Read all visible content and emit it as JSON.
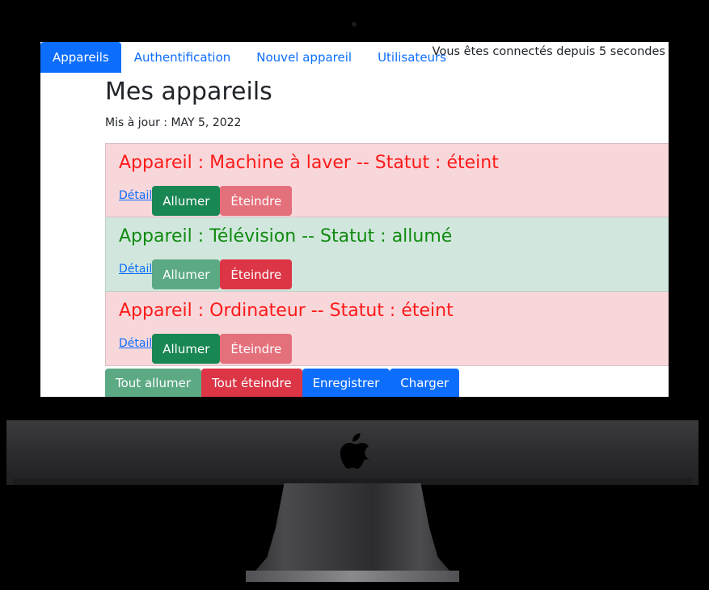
{
  "nav": {
    "items": [
      {
        "label": "Appareils",
        "active": true
      },
      {
        "label": "Authentification",
        "active": false
      },
      {
        "label": "Nouvel appareil",
        "active": false
      },
      {
        "label": "Utilisateurs",
        "active": false
      }
    ],
    "connected_text": "Vous êtes connectés depuis 5 secondes"
  },
  "main": {
    "title": "Mes appareils",
    "updated": "Mis à jour : MAY 5, 2022"
  },
  "devices": [
    {
      "title": "Appareil : Machine à laver -- Statut : éteint",
      "status": "off",
      "detail_label": "Détail",
      "on_label": "Allumer",
      "off_label": "Éteindre"
    },
    {
      "title": "Appareil : Télévision -- Statut : allumé",
      "status": "on",
      "detail_label": "Détail",
      "on_label": "Allumer",
      "off_label": "Éteindre"
    },
    {
      "title": "Appareil : Ordinateur -- Statut : éteint",
      "status": "off",
      "detail_label": "Détail",
      "on_label": "Allumer",
      "off_label": "Éteindre"
    }
  ],
  "actions": {
    "all_on": "Tout allumer",
    "all_off": "Tout éteindre",
    "save": "Enregistrer",
    "load": "Charger"
  },
  "colors": {
    "primary": "#0d6efd",
    "success": "#198754",
    "danger": "#dc3545",
    "off_bg": "#f8d7da",
    "on_bg": "#d1e7dd"
  },
  "icons": {
    "brand": "apple-logo-icon"
  }
}
